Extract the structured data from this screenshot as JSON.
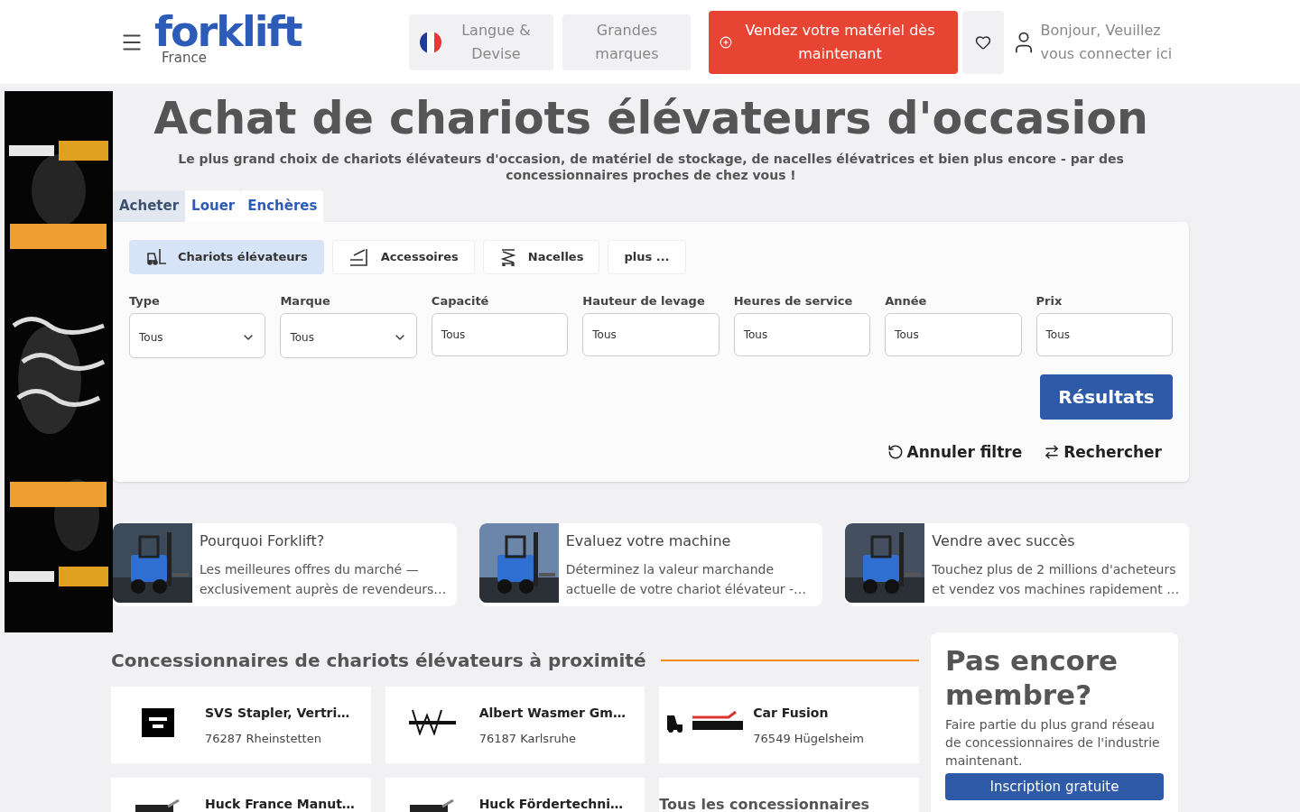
{
  "header": {
    "logo": "forklift",
    "logo_sub": "France",
    "language_button": "Langue & Devise",
    "brands_button": "Grandes marques",
    "sell_button": "Vendez votre matériel dès maintenant",
    "login": "Bonjour, Veuillez vous connecter ici"
  },
  "hero": {
    "title": "Achat de chariots élévateurs d'occasion",
    "subtitle": "Le plus grand choix de chariots élévateurs d'occasion, de matériel de stockage, de nacelles élévatrices et bien plus encore - par des concessionnaires proches de chez vous !"
  },
  "tabs": [
    {
      "label": "Acheter",
      "selected": true
    },
    {
      "label": "Louer",
      "selected": false
    },
    {
      "label": "Enchères",
      "selected": false
    }
  ],
  "categories": [
    {
      "label": "Chariots élévateurs",
      "kind": "forklift",
      "selected": true
    },
    {
      "label": "Accessoires",
      "kind": "forks",
      "selected": false
    },
    {
      "label": "Nacelles",
      "kind": "lift",
      "selected": false
    },
    {
      "label": "plus ...",
      "kind": "more",
      "selected": false
    }
  ],
  "filters": [
    {
      "label": "Type",
      "value": "Tous",
      "kind": "select"
    },
    {
      "label": "Marque",
      "value": "Tous",
      "kind": "select"
    },
    {
      "label": "Capacité",
      "value": "Tous",
      "kind": "input"
    },
    {
      "label": "Hauteur de levage",
      "value": "Tous",
      "kind": "input"
    },
    {
      "label": "Heures de service",
      "value": "Tous",
      "kind": "input"
    },
    {
      "label": "Année",
      "value": "Tous",
      "kind": "input"
    },
    {
      "label": "Prix",
      "value": "Tous",
      "kind": "input"
    }
  ],
  "results_button": "Résultats",
  "reset_link": "Annuler filtre",
  "search_link": "Rechercher",
  "info_cards": [
    {
      "title": "Pourquoi Forklift?",
      "text": "Les meilleures offres du marché — exclusivement auprès de revendeurs…"
    },
    {
      "title": "Evaluez votre machine",
      "text": "Déterminez la valeur marchande actuelle de votre chariot élévateur -…"
    },
    {
      "title": "Vendre avec succès",
      "text": "Touchez plus de 2 millions d'acheteurs et vendez vos machines rapidement …"
    }
  ],
  "dealers": {
    "title": "Concessionnaires de chariots élévateurs à proximité",
    "items": [
      {
        "name": "SVS Stapler, Vertri…",
        "city": "76287 Rheinstetten"
      },
      {
        "name": "Albert Wasmer Gm…",
        "city": "76187 Karlsruhe"
      },
      {
        "name": "Car Fusion",
        "city": "76549 Hügelsheim"
      },
      {
        "name": "Huck France Manut…"
      },
      {
        "name": "Huck Fördertechni…"
      }
    ],
    "all_link": "Tous les concessionnaires"
  },
  "membership": {
    "title": "Pas encore membre?",
    "text": "Faire partie du plus grand réseau de concessionnaires de l'industrie maintenant.",
    "button": "Inscription gratuite"
  }
}
